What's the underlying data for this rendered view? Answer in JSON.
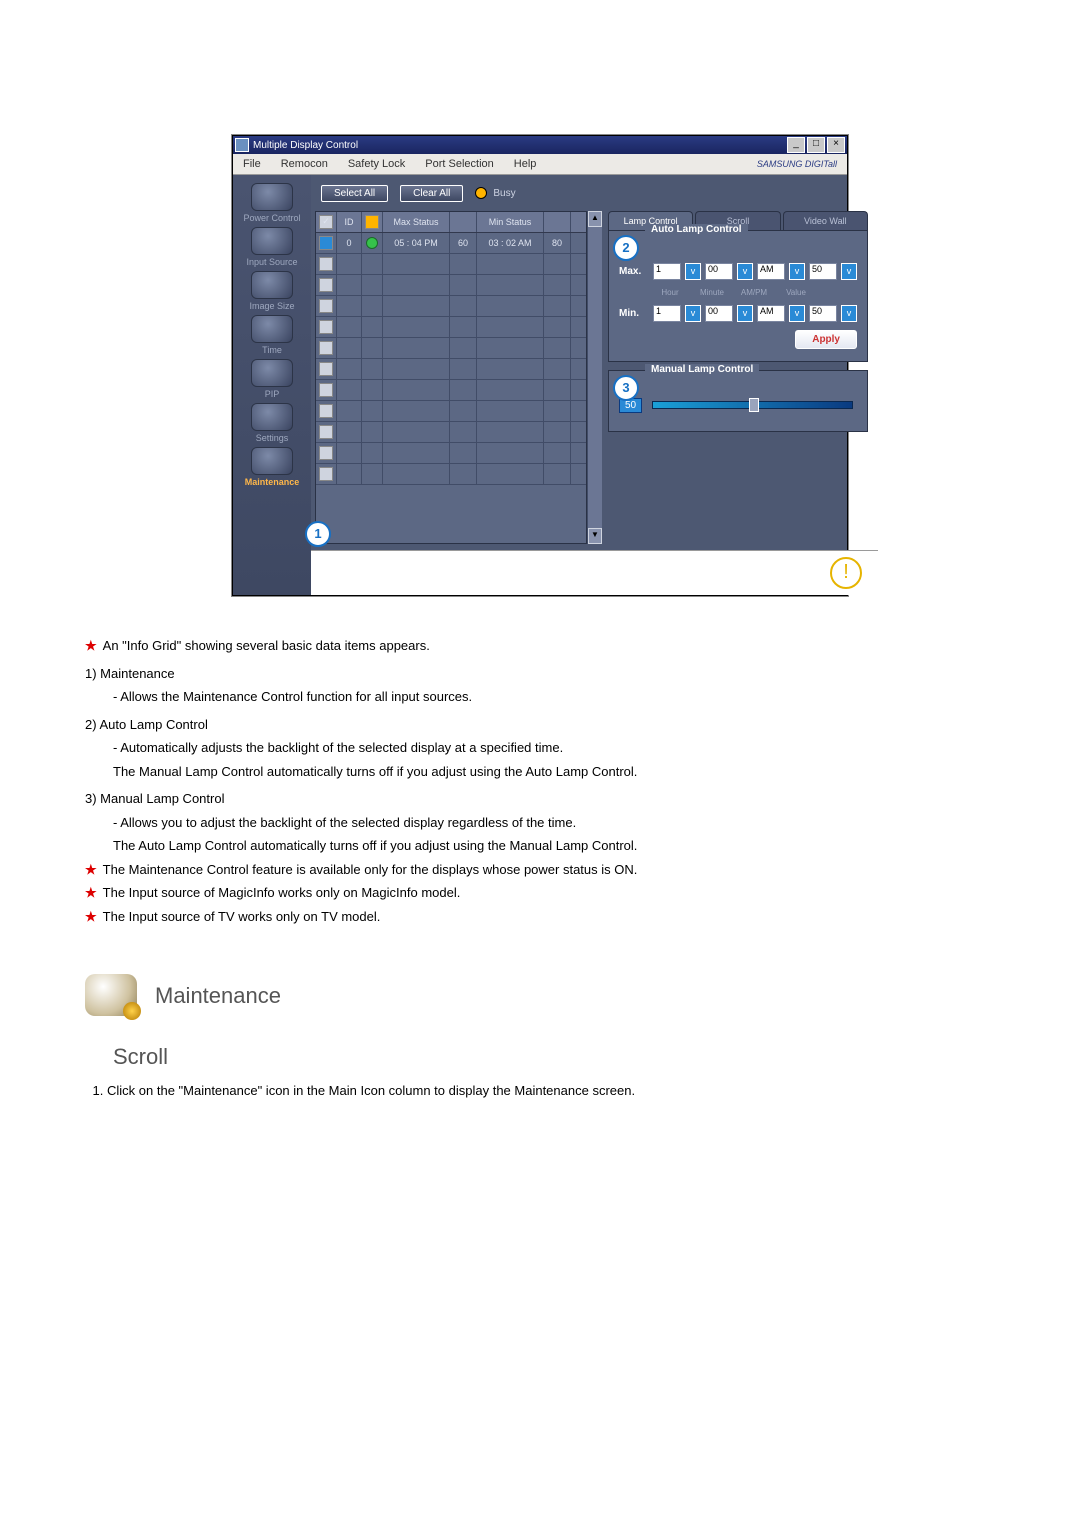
{
  "window": {
    "title": "Multiple Display Control",
    "brand": "SAMSUNG DIGITall"
  },
  "menubar": [
    "File",
    "Remocon",
    "Safety Lock",
    "Port Selection",
    "Help"
  ],
  "sidebar": {
    "items": [
      {
        "label": "Power Control"
      },
      {
        "label": "Input Source"
      },
      {
        "label": "Image Size"
      },
      {
        "label": "Time"
      },
      {
        "label": "PIP"
      },
      {
        "label": "Settings"
      },
      {
        "label": "Maintenance"
      }
    ]
  },
  "toolbar": {
    "select_all": "Select All",
    "clear_all": "Clear All",
    "busy": "Busy"
  },
  "grid": {
    "headers": {
      "id": "ID",
      "max_status": "Max Status",
      "min_status": "Min Status"
    },
    "row0": {
      "id": "0",
      "max_status": "05 : 04 PM",
      "max_val": "60",
      "min_status": "03 : 02 AM",
      "min_val": "80"
    }
  },
  "tabs": {
    "lamp": "Lamp Control",
    "scroll": "Scroll",
    "videowall": "Video Wall"
  },
  "auto_panel": {
    "legend": "Auto Lamp Control",
    "max_label": "Max.",
    "min_label": "Min.",
    "hour1": "1",
    "minute": "00",
    "ampm": "AM",
    "value": "50",
    "sub_hour": "Hour",
    "sub_minute": "Minute",
    "sub_ampm": "AM/PM",
    "sub_value": "Value",
    "apply": "Apply"
  },
  "manual_panel": {
    "legend": "Manual Lamp Control",
    "value": "50"
  },
  "callouts": {
    "c1": "1",
    "c2": "2",
    "c3": "3"
  },
  "doc": {
    "l1": "An \"Info Grid\" showing several basic data items appears.",
    "n1": "1)  Maintenance",
    "n1a": "- Allows the Maintenance Control function for all input sources.",
    "n2": "2)  Auto Lamp Control",
    "n2a": "- Automatically adjusts the backlight of the selected display at a specified time.",
    "n2b": "The Manual Lamp Control automatically turns off if you adjust using the Auto Lamp Control.",
    "n3": "3)  Manual Lamp Control",
    "n3a": "- Allows you to adjust the backlight of the selected display regardless of the time.",
    "n3b": "The Auto Lamp Control automatically turns off if you adjust using the Manual Lamp Control.",
    "s1": "The Maintenance Control feature is available only for the displays whose power status is ON.",
    "s2": "The Input source of MagicInfo works only on MagicInfo model.",
    "s3": "The Input source of TV works only on TV model.",
    "section": "Maintenance",
    "subsection": "Scroll",
    "step1": "Click on the \"Maintenance\" icon in the Main Icon column to display the Maintenance screen."
  }
}
